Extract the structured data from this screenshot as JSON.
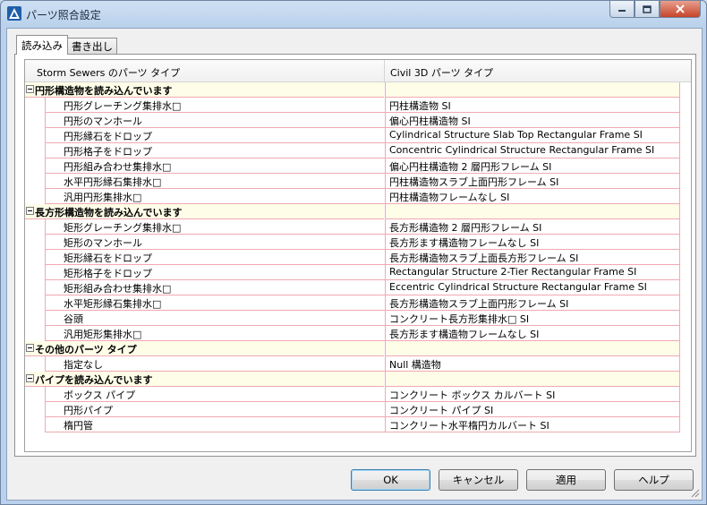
{
  "window": {
    "title": "パーツ照合設定"
  },
  "tabs": [
    {
      "label": "読み込み",
      "active": true
    },
    {
      "label": "書き出し",
      "active": false
    }
  ],
  "grid": {
    "columns": [
      "Storm Sewers のパーツ タイプ",
      "Civil 3D パーツ タイプ"
    ],
    "groups": [
      {
        "label": "円形構造物を読み込んでいます",
        "rows": [
          [
            "円形グレーチング集排水□",
            "円柱構造物 SI"
          ],
          [
            "円形のマンホール",
            "偏心円柱構造物 SI"
          ],
          [
            "円形縁石をドロップ",
            "Cylindrical Structure Slab Top Rectangular Frame SI"
          ],
          [
            "円形格子をドロップ",
            "Concentric Cylindrical Structure Rectangular Frame SI"
          ],
          [
            "円形組み合わせ集排水□",
            "偏心円柱構造物 2 層円形フレーム SI"
          ],
          [
            "水平円形縁石集排水□",
            "円柱構造物スラブ上面円形フレーム SI"
          ],
          [
            "汎用円形集排水□",
            "円柱構造物フレームなし SI"
          ]
        ]
      },
      {
        "label": "長方形構造物を読み込んでいます",
        "rows": [
          [
            "矩形グレーチング集排水□",
            "長方形構造物 2 層円形フレーム SI"
          ],
          [
            "矩形のマンホール",
            "長方形ます構造物フレームなし SI"
          ],
          [
            "矩形縁石をドロップ",
            "長方形構造物スラブ上面長方形フレーム SI"
          ],
          [
            "矩形格子をドロップ",
            "Rectangular Structure 2-Tier Rectangular Frame SI"
          ],
          [
            "矩形組み合わせ集排水□",
            "Eccentric Cylindrical Structure Rectangular Frame SI"
          ],
          [
            "水平矩形縁石集排水□",
            "長方形構造物スラブ上面円形フレーム SI"
          ],
          [
            "谷頭",
            "コンクリート長方形集排水□ SI"
          ],
          [
            "汎用矩形集排水□",
            "長方形ます構造物フレームなし SI"
          ]
        ]
      },
      {
        "label": "その他のパーツ タイプ",
        "rows": [
          [
            "指定なし",
            "Null 構造物"
          ]
        ]
      },
      {
        "label": "パイプを読み込んでいます",
        "rows": [
          [
            "ボックス パイプ",
            "コンクリート ボックス カルバート SI"
          ],
          [
            "円形パイプ",
            "コンクリート パイプ SI"
          ],
          [
            "楕円管",
            "コンクリート水平楕円カルバート SI"
          ]
        ]
      }
    ]
  },
  "buttons": {
    "ok": "OK",
    "cancel": "キャンセル",
    "apply": "適用",
    "help": "ヘルプ"
  },
  "colors": {
    "grid_line": "#f1a9b3",
    "group_fill": "#fefde8",
    "close_button": "#c7432a"
  },
  "icons": {
    "app": "autodesk-civil-icon",
    "minimize": "minimize-icon",
    "maximize": "maximize-icon",
    "close": "close-icon",
    "expander": "collapse-minus-icon"
  }
}
